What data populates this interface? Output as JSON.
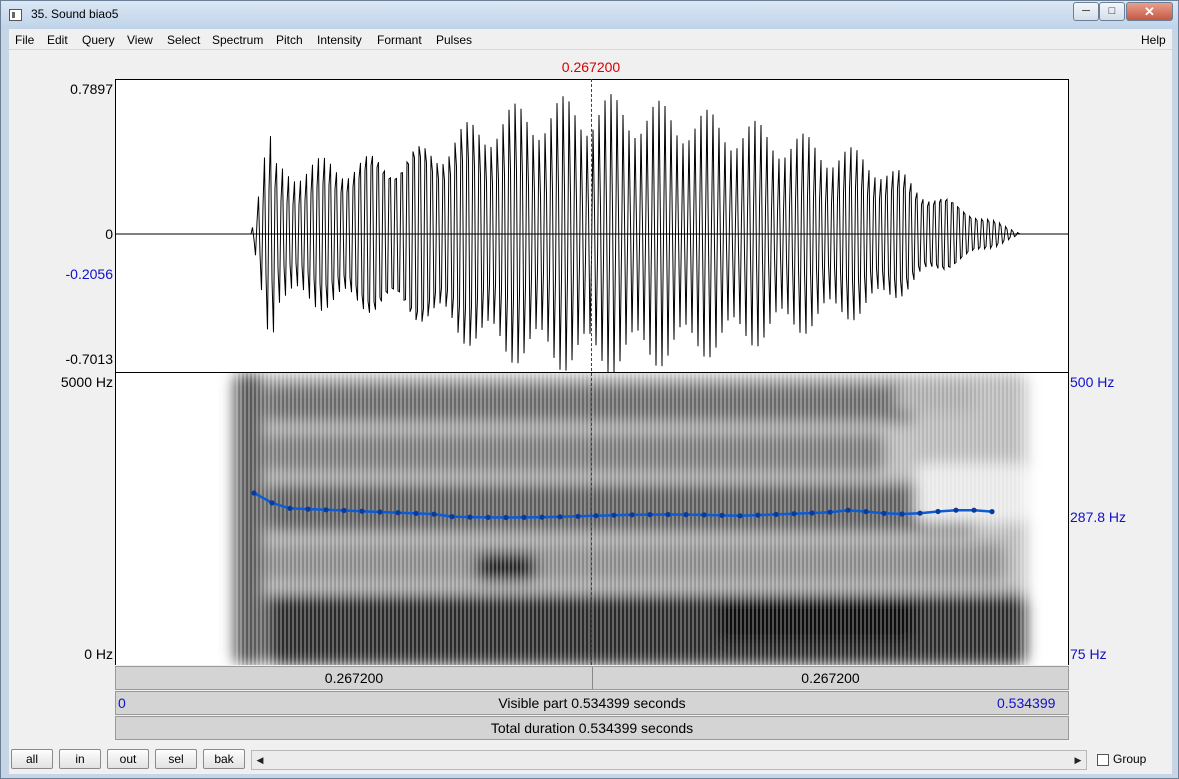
{
  "window": {
    "title": "35. Sound biao5",
    "minimize": "─",
    "maximize": "□",
    "close": "✕"
  },
  "menu": [
    "File",
    "Edit",
    "Query",
    "View",
    "Select",
    "Spectrum",
    "Pitch",
    "Intensity",
    "Formant",
    "Pulses"
  ],
  "help": "Help",
  "cursor_label": "0.267200",
  "waveform": {
    "ymax": "0.7897",
    "zero": "0",
    "cursor_value": "-0.2056",
    "ymin": "-0.7013"
  },
  "spectrogram": {
    "top_hz": "5000 Hz",
    "bottom_hz": "0 Hz",
    "pitch_top": "500 Hz",
    "pitch_cursor": "287.8 Hz",
    "pitch_bottom": "75 Hz"
  },
  "time_bar": {
    "left": "0.267200",
    "right": "0.267200"
  },
  "visible_bar": {
    "start": "0",
    "label": "Visible part 0.534399 seconds",
    "end": "0.534399"
  },
  "total_bar": {
    "label": "Total duration 0.534399 seconds"
  },
  "buttons": {
    "all": "all",
    "in": "in",
    "out": "out",
    "sel": "sel",
    "bak": "bak"
  },
  "scroll": {
    "left_arrow": "◀",
    "right_arrow": "▶"
  },
  "group": {
    "label": "Group",
    "checked": false
  },
  "colors": {
    "cursor": "#d80000",
    "pitch": "#0a5cd8",
    "axis_blue": "#1010c8"
  }
}
